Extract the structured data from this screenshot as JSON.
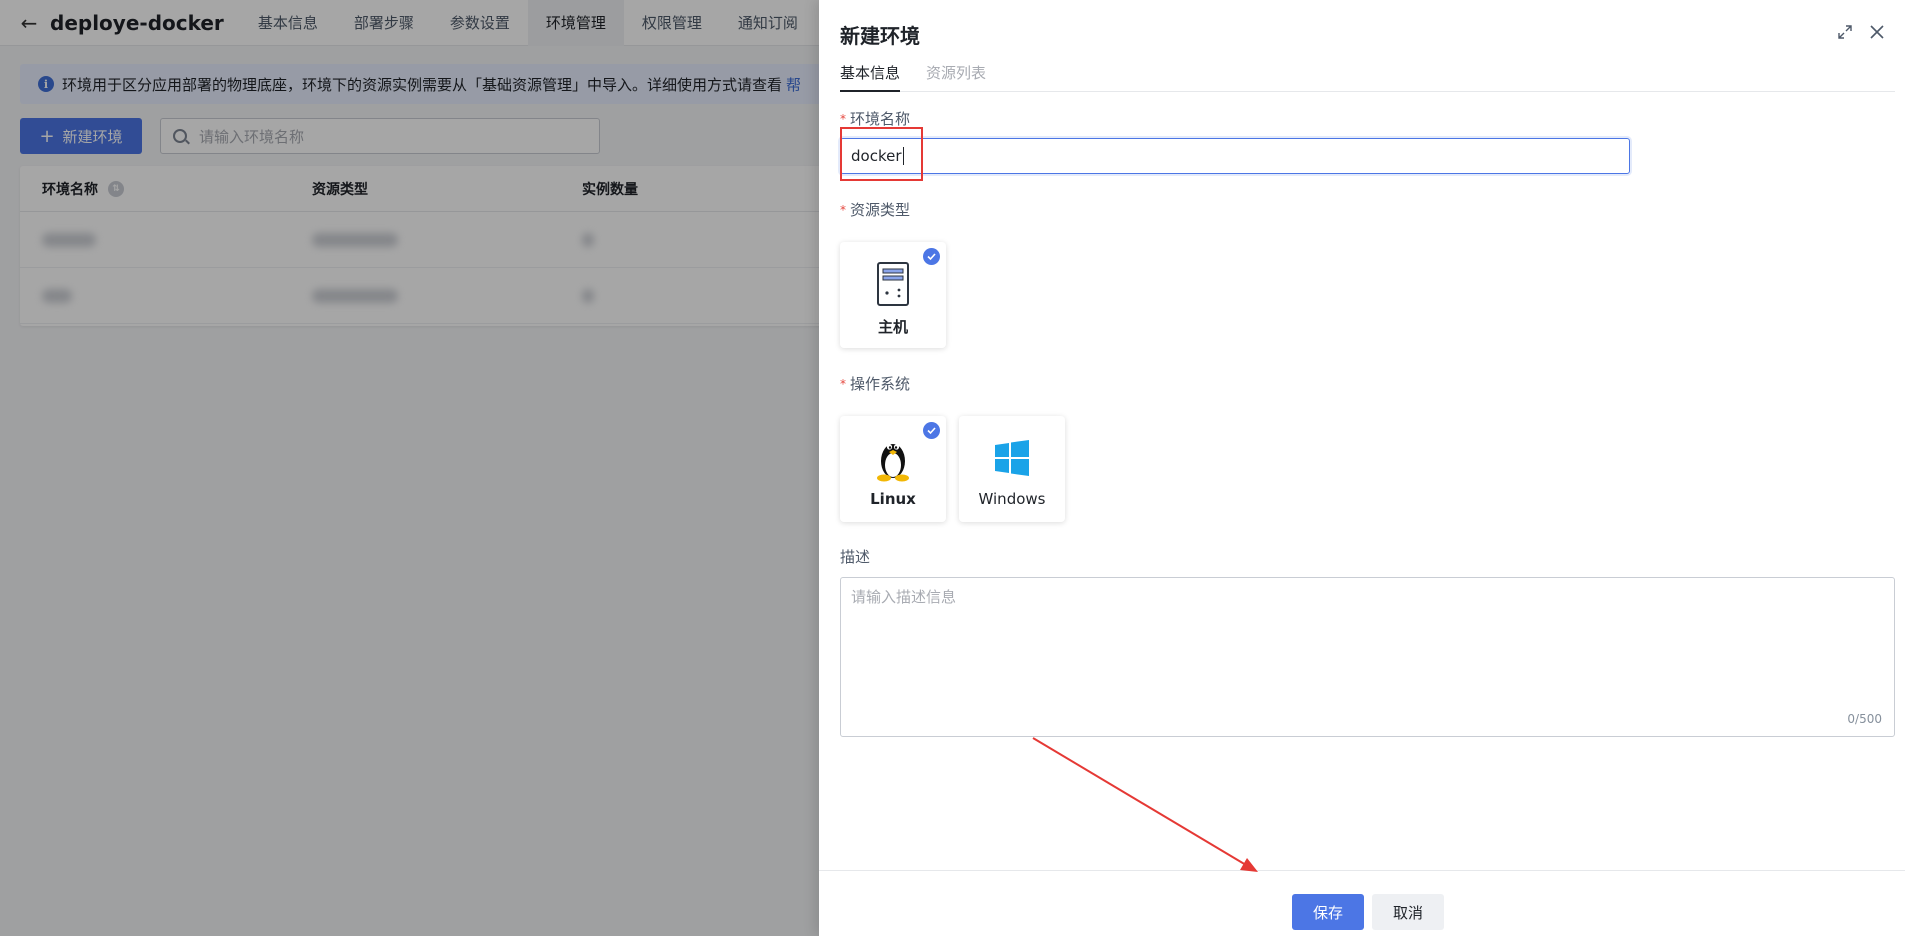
{
  "header": {
    "project_title": "deploye-docker",
    "tabs": [
      {
        "label": "基本信息"
      },
      {
        "label": "部署步骤"
      },
      {
        "label": "参数设置"
      },
      {
        "label": "环境管理"
      },
      {
        "label": "权限管理"
      },
      {
        "label": "通知订阅"
      }
    ],
    "active_tab": "环境管理"
  },
  "info_bar": {
    "text": "环境用于区分应用部署的物理底座，环境下的资源实例需要从「基础资源管理」中导入。详细使用方式请查看",
    "link": "帮"
  },
  "toolbar": {
    "new_button": "新建环境",
    "search_placeholder": "请输入环境名称"
  },
  "table": {
    "columns": [
      "环境名称",
      "资源类型",
      "实例数量"
    ]
  },
  "drawer": {
    "title": "新建环境",
    "tabs": [
      {
        "label": "基本信息"
      },
      {
        "label": "资源列表"
      }
    ],
    "name_label": "环境名称",
    "name_value": "docker",
    "resource_type_label": "资源类型",
    "resource_types": [
      {
        "label": "主机",
        "selected": true,
        "icon": "server-icon"
      }
    ],
    "os_label": "操作系统",
    "os_options": [
      {
        "label": "Linux",
        "selected": true,
        "icon": "linux-penguin-icon"
      },
      {
        "label": "Windows",
        "selected": false,
        "icon": "windows-logo-icon"
      }
    ],
    "description_label": "描述",
    "description_placeholder": "请输入描述信息",
    "description_counter": "0/500",
    "save_button": "保存",
    "cancel_button": "取消"
  },
  "colors": {
    "primary": "#4c76e5",
    "required": "#e5483f",
    "annotation_red": "#e53935",
    "windows_blue": "#1aa3e8"
  }
}
